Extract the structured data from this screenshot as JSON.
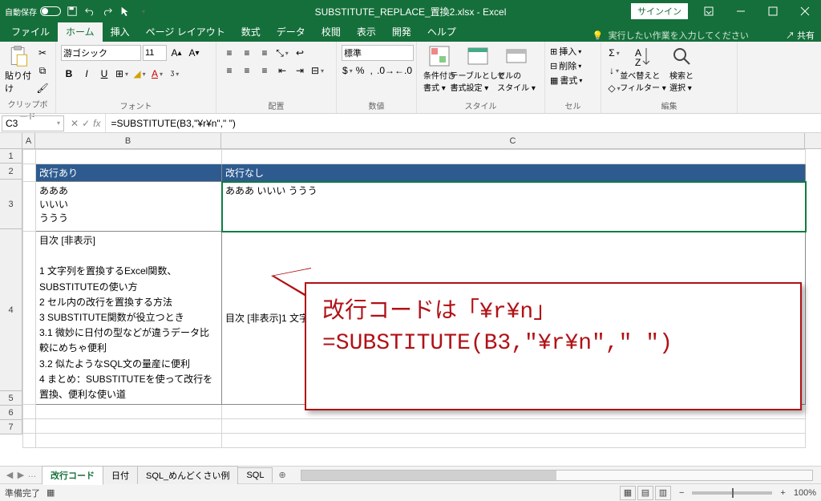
{
  "titlebar": {
    "autosave_label": "自動保存",
    "title": "SUBSTITUTE_REPLACE_置換2.xlsx - Excel",
    "signin": "サインイン"
  },
  "tabs": {
    "file": "ファイル",
    "home": "ホーム",
    "insert": "挿入",
    "layout": "ページ レイアウト",
    "formulas": "数式",
    "data": "データ",
    "review": "校閲",
    "view": "表示",
    "developer": "開発",
    "help": "ヘルプ",
    "tellme": "実行したい作業を入力してください",
    "share": "共有"
  },
  "ribbon": {
    "clipboard": {
      "paste": "貼り付け",
      "label": "クリップボード"
    },
    "font": {
      "name": "游ゴシック",
      "size": "11",
      "label": "フォント"
    },
    "align": {
      "label": "配置"
    },
    "number": {
      "format": "標準",
      "label": "数値"
    },
    "styles": {
      "cond": "条件付き\n書式 ▾",
      "table": "テーブルとして\n書式設定 ▾",
      "cell": "セルの\nスタイル ▾",
      "label": "スタイル"
    },
    "cells": {
      "insert": "挿入",
      "delete": "削除",
      "format": "書式",
      "label": "セル"
    },
    "editing": {
      "sort": "並べ替えと\nフィルター ▾",
      "find": "検索と\n選択 ▾",
      "label": "編集"
    }
  },
  "formula_bar": {
    "cell_ref": "C3",
    "formula": "=SUBSTITUTE(B3,\"¥r¥n\",\" \")"
  },
  "columns": [
    "A",
    "B",
    "C"
  ],
  "rows": [
    "1",
    "2",
    "3",
    "4",
    "5",
    "6",
    "7"
  ],
  "cells": {
    "b2": "改行あり",
    "c2": "改行なし",
    "b3": "あああ\nいいい\nううう",
    "c3": "あああ いいい ううう",
    "b4": "目次 [非表示]\n\n1 文字列を置換するExcel関数、SUBSTITUTEの使い方\n2 セル内の改行を置換する方法\n3 SUBSTITUTE関数が役立つとき\n3.1 微妙に日付の型などが違うデータ比較にめちゃ便利\n3.2 似たようなSQL文の量産に便利\n4 まとめ：SUBSTITUTEを使って改行を置換、便利な使い道",
    "c4": "目次 [非表示]1 文字列を置換するExcel関数、SUBSTITUTEの使い方2 セル内の改行を置換する方法3 SUBSTITUTE関"
  },
  "callout": {
    "line1": "改行コードは「¥r¥n」",
    "line2": "=SUBSTITUTE(B3,\"¥r¥n\",\" \")"
  },
  "sheet_tabs": {
    "t1": "改行コード",
    "t2": "日付",
    "t3": "SQL_めんどくさい例",
    "t4": "SQL"
  },
  "status": {
    "ready": "準備完了",
    "zoom": "100%"
  }
}
